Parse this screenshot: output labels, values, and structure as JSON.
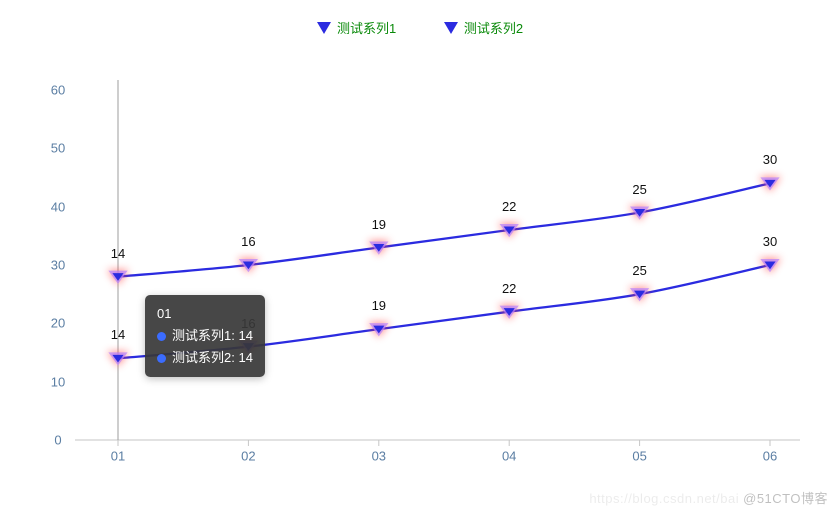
{
  "chart_data": {
    "type": "line",
    "categories": [
      "01",
      "02",
      "03",
      "04",
      "05",
      "06"
    ],
    "series": [
      {
        "name": "测试系列1",
        "values": [
          14,
          16,
          19,
          22,
          25,
          30
        ],
        "y_offset": 14
      },
      {
        "name": "测试系列2",
        "values": [
          14,
          16,
          19,
          22,
          25,
          30
        ],
        "y_offset": 0
      }
    ],
    "ylabel": "",
    "xlabel": "",
    "ylim": [
      0,
      60
    ],
    "yticks": [
      0,
      10,
      20,
      30,
      40,
      50,
      60
    ],
    "legend_position": "top-center",
    "colors": {
      "line": "#2b2be0",
      "marker_outer": "#b580ff",
      "marker_glow": "#ff3b3b",
      "legend_text": "#0a8a0a",
      "axis_text": "#5b7ea3"
    }
  },
  "tooltip": {
    "title": "01",
    "rows": [
      {
        "series": "测试系列1",
        "value": 14
      },
      {
        "series": "测试系列2",
        "value": 14
      }
    ]
  },
  "watermark": {
    "faint": "https://blog.csdn.net/bai",
    "main": "@51CTO博客"
  }
}
